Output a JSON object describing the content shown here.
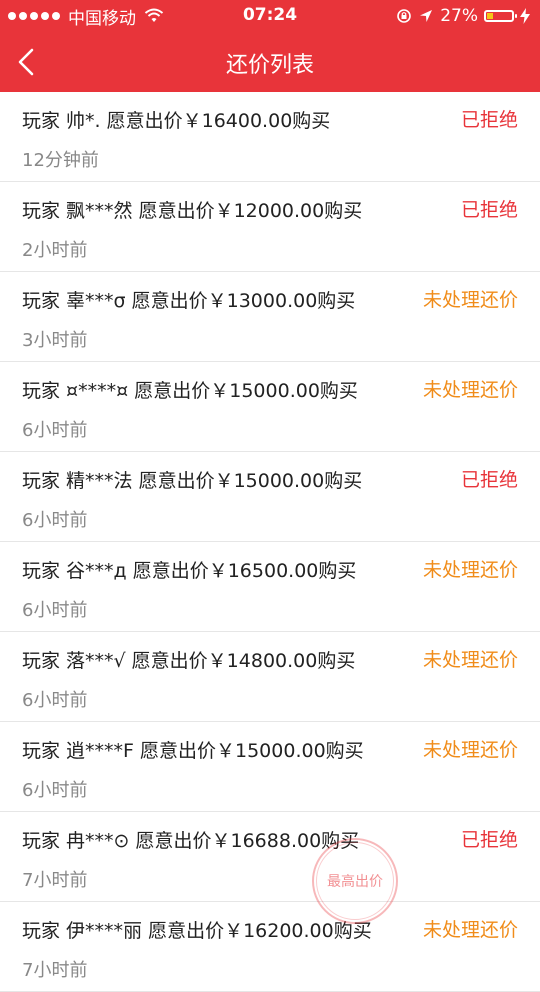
{
  "status_bar": {
    "carrier": "中国移动",
    "time": "07:24",
    "battery": "27%",
    "battery_level": 0.27
  },
  "header": {
    "title": "还价列表"
  },
  "colors": {
    "brand": "#e8343a",
    "rejected": "#e8343a",
    "pending": "#f08c1a"
  },
  "offers": [
    {
      "text": "玩家 帅*.   愿意出价￥16400.00购买",
      "time": "12分钟前",
      "status": "已拒绝"
    },
    {
      "text": "玩家 飘***然 愿意出价￥12000.00购买",
      "time": "2小时前",
      "status": "已拒绝"
    },
    {
      "text": "玩家 辜***σ 愿意出价￥13000.00购买",
      "time": "3小时前",
      "status": "未处理还价"
    },
    {
      "text": "玩家 ¤****¤ 愿意出价￥15000.00购买",
      "time": "6小时前",
      "status": "未处理还价"
    },
    {
      "text": "玩家 精***法 愿意出价￥15000.00购买",
      "time": "6小时前",
      "status": "已拒绝"
    },
    {
      "text": "玩家 谷***д 愿意出价￥16500.00购买",
      "time": "6小时前",
      "status": "未处理还价"
    },
    {
      "text": "玩家 落***√ 愿意出价￥14800.00购买",
      "time": "6小时前",
      "status": "未处理还价"
    },
    {
      "text": "玩家 逍****F 愿意出价￥15000.00购买",
      "time": "6小时前",
      "status": "未处理还价"
    },
    {
      "text": "玩家 冉***⊙ 愿意出价￥16688.00购买",
      "time": "7小时前",
      "status": "已拒绝"
    },
    {
      "text": "玩家 伊****丽 愿意出价￥16200.00购买",
      "time": "7小时前",
      "status": "未处理还价"
    }
  ],
  "stamp": {
    "label": "最高出价"
  },
  "icons": {
    "back": "chevron-left-icon",
    "wifi": "wifi-icon",
    "lock": "rotation-lock-icon",
    "location": "location-arrow-icon",
    "battery": "battery-icon",
    "charging": "charging-bolt-icon"
  }
}
